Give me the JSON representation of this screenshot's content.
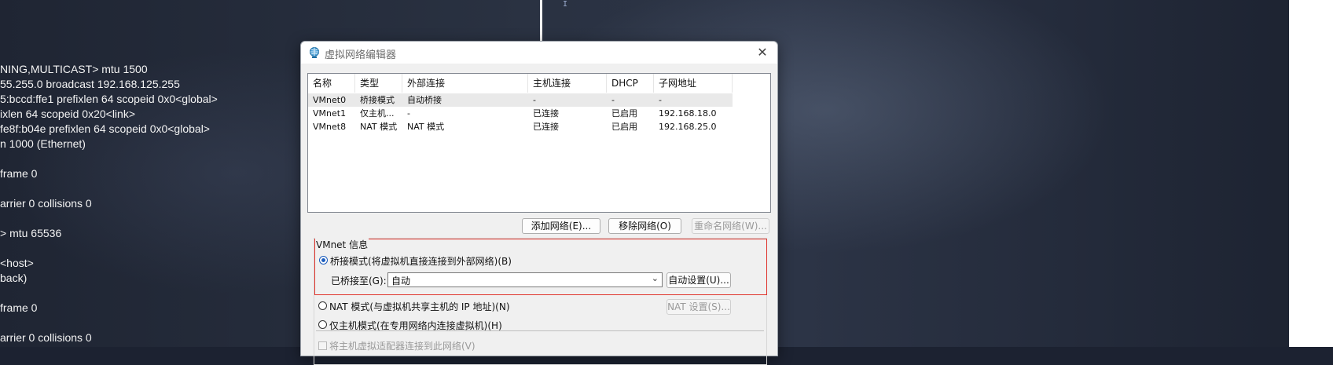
{
  "terminal": {
    "lines": [
      "NING,MULTICAST>  mtu 1500",
      "55.255.0  broadcast 192.168.125.255",
      "5:bccd:ffe1  prefixlen 64  scopeid 0x0<global>",
      "ixlen 64  scopeid 0x20<link>",
      "fe8f:b04e  prefixlen 64  scopeid 0x0<global>",
      "n 1000  (Ethernet)",
      "frame 0",
      "arrier 0  collisions 0",
      ">  mtu 65536",
      "<host>",
      "back)",
      "frame 0",
      "arrier 0  collisions 0"
    ]
  },
  "dialog": {
    "title": "虚拟网络编辑器",
    "close_glyph": "✕",
    "columns": {
      "name": "名称",
      "type": "类型",
      "external": "外部连接",
      "host": "主机连接",
      "dhcp": "DHCP",
      "subnet": "子网地址"
    },
    "networks": [
      {
        "name": "VMnet0",
        "type": "桥接模式",
        "external": "自动桥接",
        "host": "-",
        "dhcp": "-",
        "subnet": "-"
      },
      {
        "name": "VMnet1",
        "type": "仅主机...",
        "external": "-",
        "host": "已连接",
        "dhcp": "已启用",
        "subnet": "192.168.18.0"
      },
      {
        "name": "VMnet8",
        "type": "NAT 模式",
        "external": "NAT 模式",
        "host": "已连接",
        "dhcp": "已启用",
        "subnet": "192.168.25.0"
      }
    ],
    "buttons": {
      "add": "添加网络(E)...",
      "remove": "移除网络(O)",
      "rename": "重命名网络(W)..."
    },
    "vmnet_info": {
      "group_title": "VMnet 信息",
      "bridge_option": "桥接模式(将虚拟机直接连接到外部网络)(B)",
      "bridged_to_label": "已桥接至(G):",
      "bridged_to_value": "自动",
      "auto_settings": "自动设置(U)...",
      "nat_option": "NAT 模式(与虚拟机共享主机的 IP 地址)(N)",
      "nat_settings": "NAT 设置(S)...",
      "hostonly_option": "仅主机模式(在专用网络内连接虚拟机)(H)",
      "adapter_checkbox": "将主机虚拟适配器连接到此网络(V)"
    }
  },
  "colors": {
    "highlight_border": "#e0342c",
    "radio_accent": "#1e5ebd"
  }
}
